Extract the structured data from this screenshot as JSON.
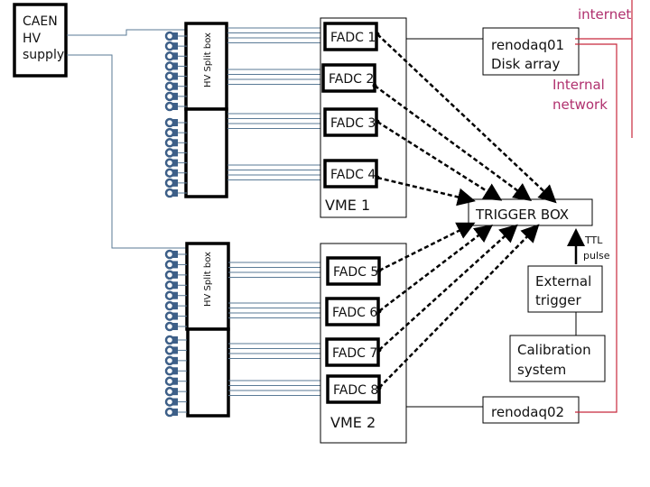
{
  "hv_supply": {
    "lines": [
      "CAEN",
      "HV",
      "supply"
    ]
  },
  "split_box_label": "HV Split box",
  "vme1": {
    "label": "VME 1",
    "fadcs": [
      "FADC 1",
      "FADC 2",
      "FADC 3",
      "FADC 4"
    ]
  },
  "vme2": {
    "label": "VME 2",
    "fadcs": [
      "FADC 5",
      "FADC 6",
      "FADC 7",
      "FADC 8"
    ]
  },
  "renodaq01": {
    "lines": [
      "renodaq01",
      "Disk array"
    ]
  },
  "renodaq02": {
    "label": "renodaq02"
  },
  "internet": "internet",
  "internal_network": [
    "Internal",
    "network"
  ],
  "trigger_box": "TRIGGER BOX",
  "ttl_pulse": [
    "TTL",
    "pulse"
  ],
  "external_trigger": [
    "External",
    "trigger"
  ],
  "calibration": [
    "Calibration",
    "system"
  ],
  "colors": {
    "hv_wire": "#5a7a96",
    "network": "#c8283c",
    "network_text": "#b0306e"
  }
}
